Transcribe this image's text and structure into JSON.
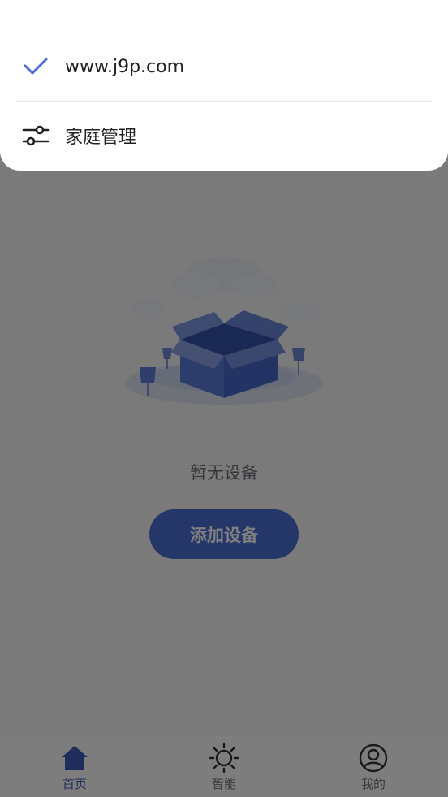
{
  "dropdown": {
    "items": [
      {
        "label": "www.j9p.com",
        "icon": "check-icon",
        "selected": true
      },
      {
        "label": "家庭管理",
        "icon": "sliders-icon",
        "selected": false
      }
    ]
  },
  "empty_state": {
    "message": "暂无设备",
    "button_label": "添加设备"
  },
  "tabbar": {
    "tabs": [
      {
        "label": "首页",
        "icon": "home-icon",
        "active": true
      },
      {
        "label": "智能",
        "icon": "sun-icon",
        "active": false
      },
      {
        "label": "我的",
        "icon": "user-icon",
        "active": false
      }
    ]
  },
  "colors": {
    "accent": "#4a6cd3",
    "active_tab": "#3d5bb8",
    "overlay": "rgba(0,0,0,0.5)"
  }
}
